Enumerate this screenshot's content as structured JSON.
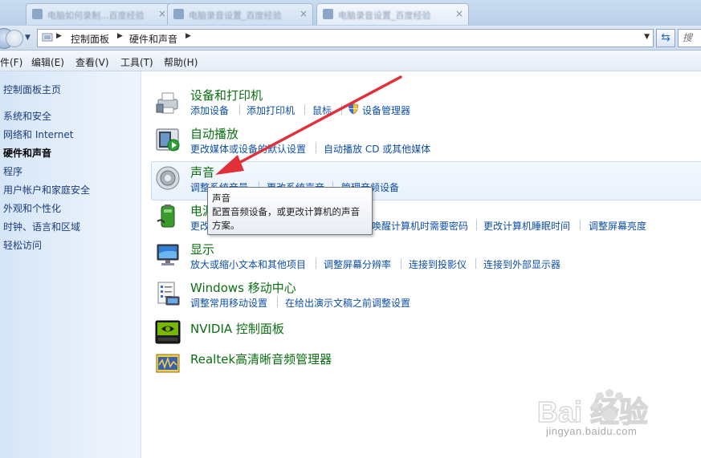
{
  "tabs": [
    {
      "label": "电脑如何录制...百度经验"
    },
    {
      "label": "电脑录音设置_百度经验"
    },
    {
      "label": "电脑录音设置_百度经验"
    }
  ],
  "address": {
    "breadcrumb": [
      "控制面板",
      "硬件和声音"
    ],
    "search_placeholder": "搜"
  },
  "menu": [
    "件(F)",
    "编辑(E)",
    "查看(V)",
    "工具(T)",
    "帮助(H)"
  ],
  "sidebar": {
    "home": "控制面板主页",
    "items": [
      "系统和安全",
      "网络和 Internet",
      "硬件和声音",
      "程序",
      "用户帐户和家庭安全",
      "外观和个性化",
      "时钟、语言和区域",
      "轻松访问"
    ]
  },
  "categories": {
    "devices": {
      "title": "设备和打印机",
      "links": [
        "添加设备",
        "添加打印机",
        "鼠标",
        "设备管理器"
      ]
    },
    "autoplay": {
      "title": "自动播放",
      "links": [
        "更改媒体或设备的默认设置",
        "自动播放 CD 或其他媒体"
      ]
    },
    "sound": {
      "title": "声音",
      "links": [
        "调整系统音量",
        "更改系统声音",
        "管理音频设备"
      ]
    },
    "power": {
      "title": "电源选项",
      "links": [
        "更改",
        "唤醒计算机时需要密码",
        "更改计算机睡眠时间",
        "调整屏幕亮度"
      ]
    },
    "display": {
      "title": "显示",
      "links": [
        "放大或缩小文本和其他项目",
        "调整屏幕分辨率",
        "连接到投影仪",
        "连接到外部显示器"
      ]
    },
    "mobility": {
      "title": "Windows 移动中心",
      "links": [
        "调整常用移动设置",
        "在给出演示文稿之前调整设置"
      ]
    },
    "nvidia": {
      "title": "NVIDIA 控制面板"
    },
    "realtek": {
      "title": "Realtek高清晰音频管理器"
    }
  },
  "tooltip": {
    "title": "声音",
    "line1": "配置音频设备，或更改计算机的声音",
    "line2": "方案。"
  },
  "watermark": {
    "logo_text": "Bai 经验",
    "url": "jingyan.baidu.com"
  },
  "colors": {
    "category_title": "#0b6f12",
    "link": "#0e4fa8",
    "sidebar_link": "#1a3d7c",
    "annotation_arrow": "#e0303a"
  }
}
